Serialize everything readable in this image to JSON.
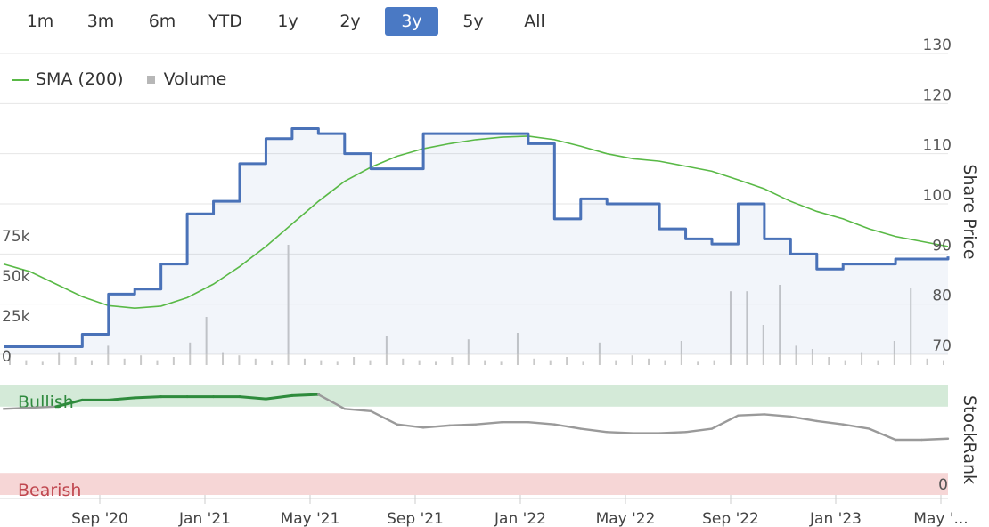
{
  "range_selector": {
    "buttons": [
      "1m",
      "3m",
      "6m",
      "YTD",
      "1y",
      "2y",
      "3y",
      "5y",
      "All"
    ],
    "active": "3y"
  },
  "legend": {
    "sma_label": "SMA (200)",
    "volume_label": "Volume"
  },
  "colors": {
    "price": "#4a72b8",
    "sma": "#59b946",
    "volume": "#c9c9c9",
    "bullish_fill": "#d4ead8",
    "bullish_text": "#2f8a3e",
    "bearish_fill": "#f6d6d6",
    "bearish_text": "#c0474f",
    "rank_neutral": "#9a9a9a",
    "rank_bull": "#2e8b3c"
  },
  "chart_data": [
    {
      "type": "line",
      "title": "",
      "ylabel": "Share Price",
      "ylim": [
        70,
        130
      ],
      "y_ticks": [
        70,
        80,
        90,
        100,
        110,
        120,
        130
      ],
      "x_ticks": [
        "Sep '20",
        "Jan '21",
        "May '21",
        "Sep '21",
        "Jan '22",
        "May '22",
        "Sep '22",
        "Jan '23",
        "May '..."
      ],
      "x": [
        "2020-06",
        "2020-07",
        "2020-08",
        "2020-09",
        "2020-10",
        "2020-11",
        "2020-12",
        "2021-01",
        "2021-02",
        "2021-03",
        "2021-04",
        "2021-05",
        "2021-06",
        "2021-07",
        "2021-08",
        "2021-09",
        "2021-10",
        "2021-11",
        "2021-12",
        "2022-01",
        "2022-02",
        "2022-03",
        "2022-04",
        "2022-05",
        "2022-06",
        "2022-07",
        "2022-08",
        "2022-09",
        "2022-10",
        "2022-11",
        "2022-12",
        "2023-01",
        "2023-02",
        "2023-03",
        "2023-04",
        "2023-05",
        "2023-06"
      ],
      "series": [
        {
          "name": "Share Price",
          "values": [
            71.5,
            71.5,
            71.5,
            74.0,
            82.0,
            83.0,
            88.0,
            98.0,
            100.5,
            108.0,
            113.0,
            115.0,
            114.0,
            110.0,
            107.0,
            107.0,
            114.0,
            114.0,
            114.0,
            114.0,
            112.0,
            97.0,
            101.0,
            100.0,
            100.0,
            95.0,
            93.0,
            92.0,
            100.0,
            93.0,
            90.0,
            87.0,
            88.0,
            88.0,
            89.0,
            89.0,
            89.5
          ]
        },
        {
          "name": "SMA (200)",
          "values": [
            88.0,
            86.5,
            84.0,
            81.5,
            79.7,
            79.2,
            79.6,
            81.3,
            84.0,
            87.5,
            91.5,
            96.0,
            100.5,
            104.5,
            107.3,
            109.5,
            111.0,
            112.0,
            112.8,
            113.3,
            113.5,
            112.8,
            111.5,
            110.0,
            109.0,
            108.5,
            107.5,
            106.5,
            104.8,
            103.0,
            100.5,
            98.5,
            97.0,
            95.0,
            93.5,
            92.5,
            91.5
          ]
        }
      ]
    },
    {
      "type": "bar",
      "ylabel": "",
      "ylim": [
        0,
        100000
      ],
      "y_ticks": [
        0,
        25000,
        50000,
        75000
      ],
      "y_tick_labels": [
        "0",
        "25k",
        "50k",
        "75k"
      ],
      "series": [
        {
          "name": "Volume",
          "values": [
            4000,
            3000,
            2000,
            8000,
            5000,
            3000,
            12000,
            4000,
            6000,
            3000,
            5000,
            14000,
            30000,
            8000,
            6000,
            4000,
            3000,
            75000,
            4000,
            3000,
            2000,
            5000,
            3000,
            18000,
            4000,
            3000,
            2000,
            5000,
            16000,
            3000,
            2000,
            20000,
            4000,
            3000,
            5000,
            2000,
            14000,
            3000,
            6000,
            4000,
            3000,
            15000,
            2000,
            3000,
            46000,
            46000,
            25000,
            50000,
            12000,
            10000,
            5000,
            3000,
            8000,
            3000,
            15000,
            48000,
            4000,
            3000
          ]
        }
      ]
    },
    {
      "type": "line",
      "ylabel": "StockRank",
      "ylim": [
        0,
        100
      ],
      "y_ticks": [
        0
      ],
      "bands": [
        {
          "label": "Bullish",
          "from": 80,
          "to": 100
        },
        {
          "label": "Bearish",
          "from": 0,
          "to": 20
        }
      ],
      "x": [
        "2020-06",
        "2020-07",
        "2020-08",
        "2020-09",
        "2020-10",
        "2020-11",
        "2020-12",
        "2021-01",
        "2021-02",
        "2021-03",
        "2021-04",
        "2021-05",
        "2021-06",
        "2021-07",
        "2021-08",
        "2021-09",
        "2021-10",
        "2021-11",
        "2021-12",
        "2022-01",
        "2022-02",
        "2022-03",
        "2022-04",
        "2022-05",
        "2022-06",
        "2022-07",
        "2022-08",
        "2022-09",
        "2022-10",
        "2022-11",
        "2022-12",
        "2023-01",
        "2023-02",
        "2023-03",
        "2023-04",
        "2023-05",
        "2023-06"
      ],
      "series": [
        {
          "name": "StockRank",
          "values": [
            78,
            79,
            80,
            86,
            86,
            88,
            89,
            89,
            89,
            89,
            87,
            90,
            91,
            78,
            76,
            64,
            61,
            63,
            64,
            66,
            66,
            64,
            60,
            57,
            56,
            56,
            57,
            60,
            72,
            73,
            71,
            67,
            64,
            60,
            50,
            50,
            51
          ]
        }
      ]
    }
  ]
}
